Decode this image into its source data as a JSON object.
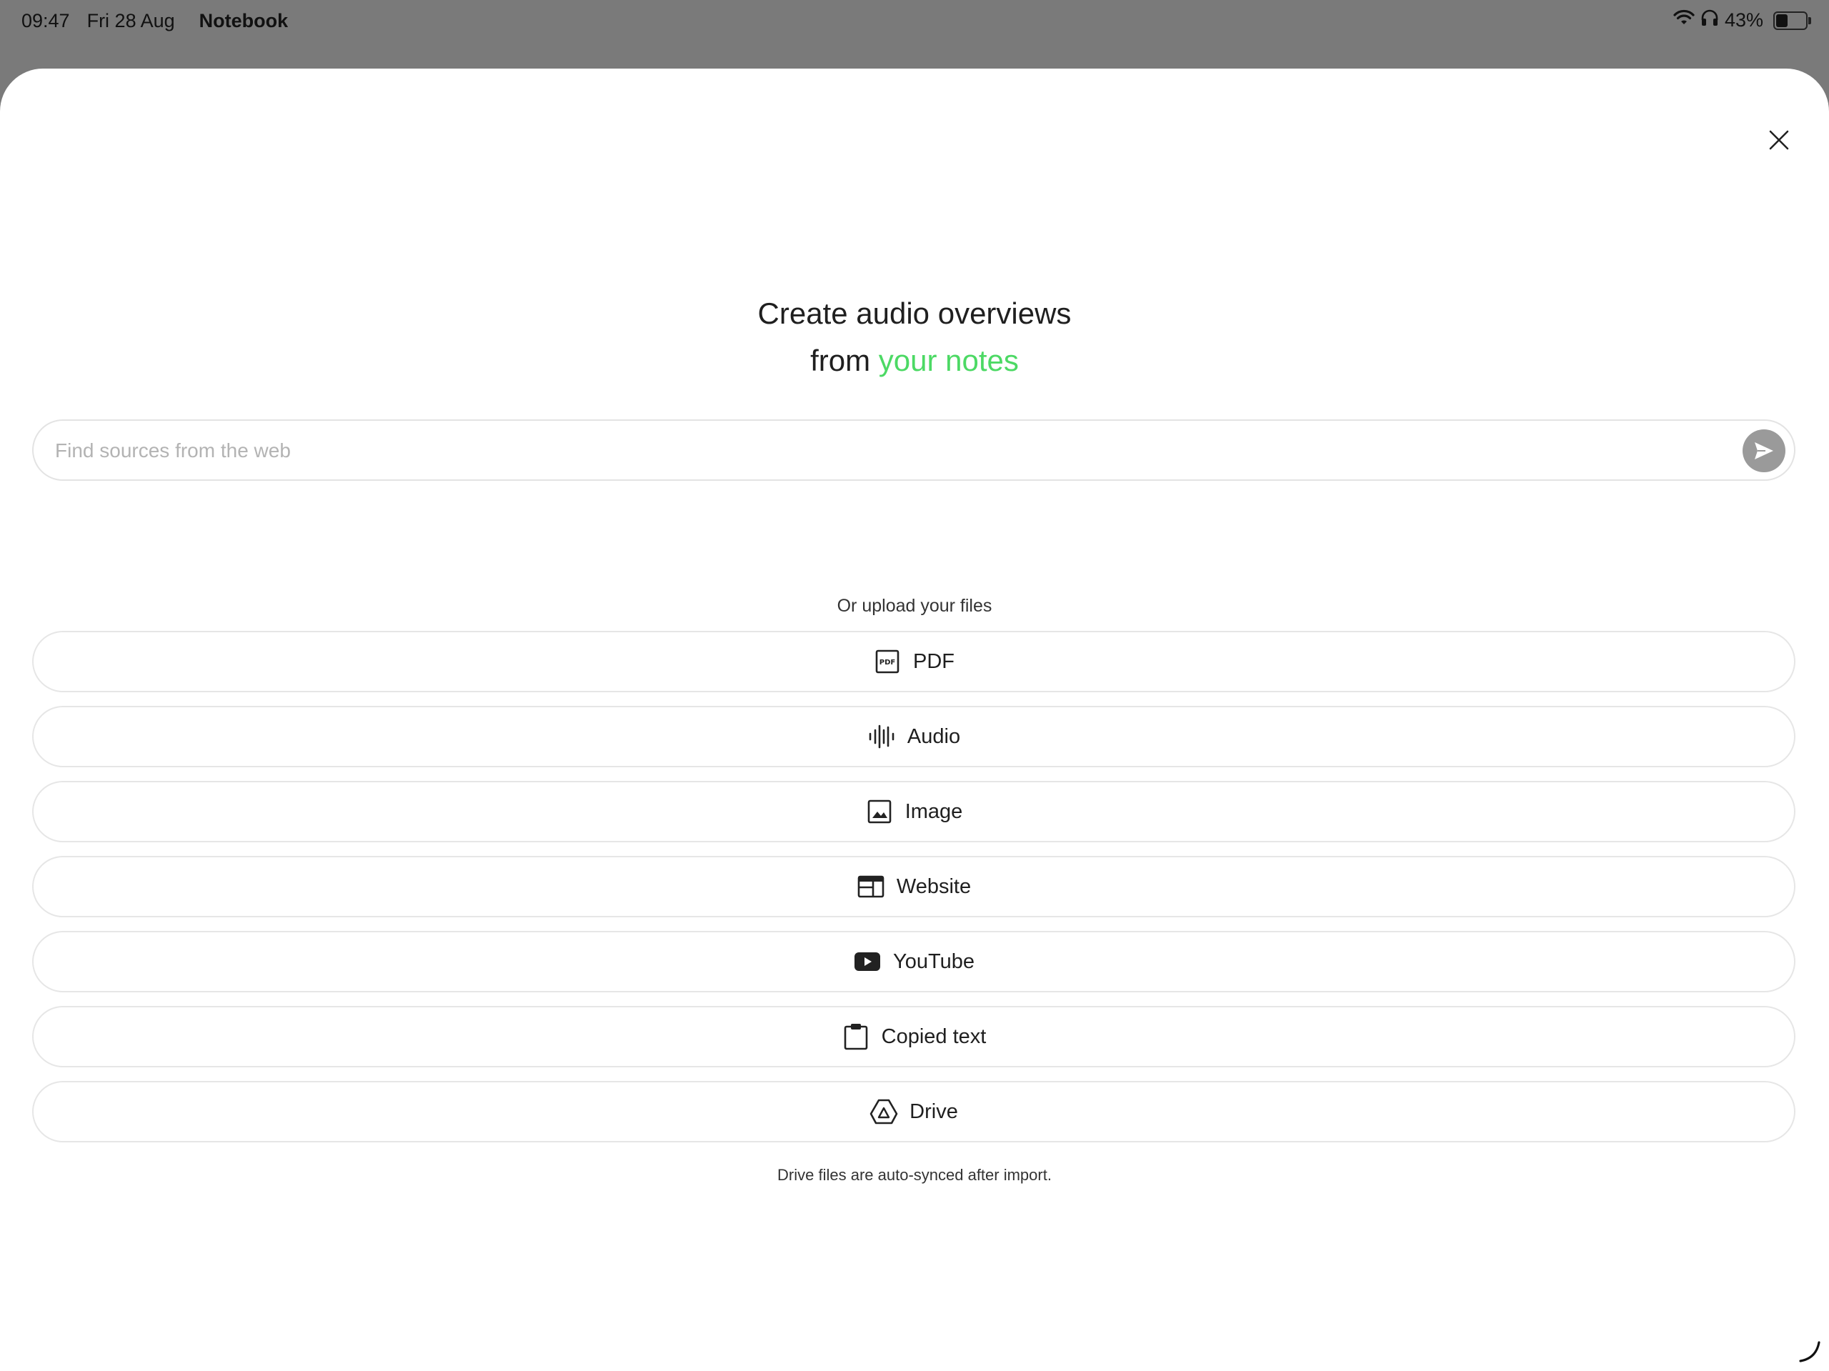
{
  "status_bar": {
    "time": "09:47",
    "date": "Fri 28 Aug",
    "app_name": "Notebook",
    "battery_percent": "43%",
    "battery_level": 0.43,
    "icons": [
      "wifi-icon",
      "headphones-icon",
      "battery-icon"
    ]
  },
  "sheet": {
    "headline_line1": "Create audio overviews",
    "headline_line2_prefix": "from",
    "headline_line2_accent": "your notes",
    "accent_color": "#4cd964",
    "search": {
      "placeholder": "Find sources from the web",
      "value": ""
    },
    "upload_label": "Or upload your files",
    "options": [
      {
        "label": "PDF",
        "icon": "pdf-icon"
      },
      {
        "label": "Audio",
        "icon": "audio-waveform-icon"
      },
      {
        "label": "Image",
        "icon": "image-icon"
      },
      {
        "label": "Website",
        "icon": "website-icon"
      },
      {
        "label": "YouTube",
        "icon": "youtube-icon"
      },
      {
        "label": "Copied text",
        "icon": "clipboard-icon"
      },
      {
        "label": "Drive",
        "icon": "drive-icon"
      }
    ],
    "footnote": "Drive files are auto-synced after import."
  }
}
